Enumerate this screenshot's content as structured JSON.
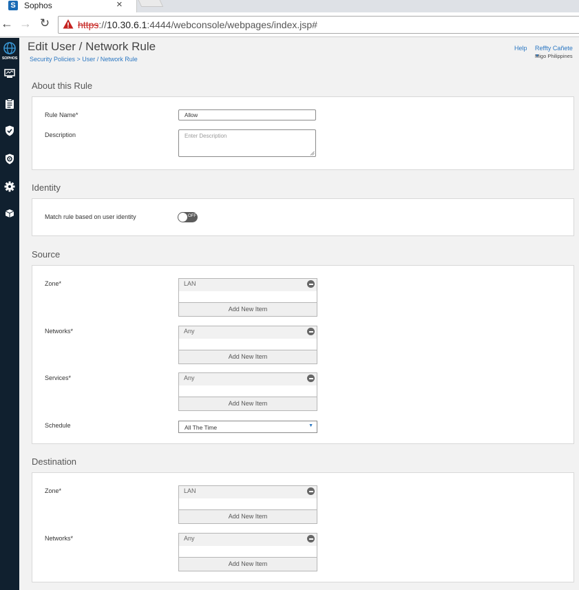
{
  "browser": {
    "tab_title": "Sophos",
    "tab_close": "×",
    "url_scheme": "https",
    "url_host": "10.30.6.1",
    "url_rest": ":4444/webconsole/webpages/index.jsp#"
  },
  "sidebar": {
    "logo_text": "SOPHOS",
    "items": [
      "monitor-icon",
      "reports-icon",
      "shield-check-icon",
      "protection-icon",
      "gear-icon",
      "box-icon"
    ]
  },
  "header": {
    "title": "Edit User / Network Rule",
    "breadcrumb": "Security Policies > User / Network Rule",
    "help": "Help",
    "user": "Reffty Cañete",
    "org": "Migo Philippines"
  },
  "sections": {
    "about": {
      "title": "About this Rule",
      "rule_name_label": "Rule Name",
      "rule_name_value": "Allow",
      "description_label": "Description",
      "description_placeholder": "Enter Description"
    },
    "identity": {
      "title": "Identity",
      "match_label": "Match rule based on user identity",
      "toggle_state": "OFF"
    },
    "source": {
      "title": "Source",
      "zone_label": "Zone",
      "zone_value": "LAN",
      "networks_label": "Networks",
      "networks_value": "Any",
      "services_label": "Services",
      "services_value": "Any",
      "schedule_label": "Schedule",
      "schedule_value": "All The Time"
    },
    "destination": {
      "title": "Destination",
      "zone_label": "Zone",
      "zone_value": "LAN",
      "networks_label": "Networks",
      "networks_value": "Any"
    }
  },
  "common": {
    "add_new_item": "Add New Item",
    "required_mark": "*"
  },
  "colors": {
    "sidebar_bg": "#10202f",
    "link_blue": "#2b77c2",
    "brand_blue": "#1a6bb5"
  }
}
